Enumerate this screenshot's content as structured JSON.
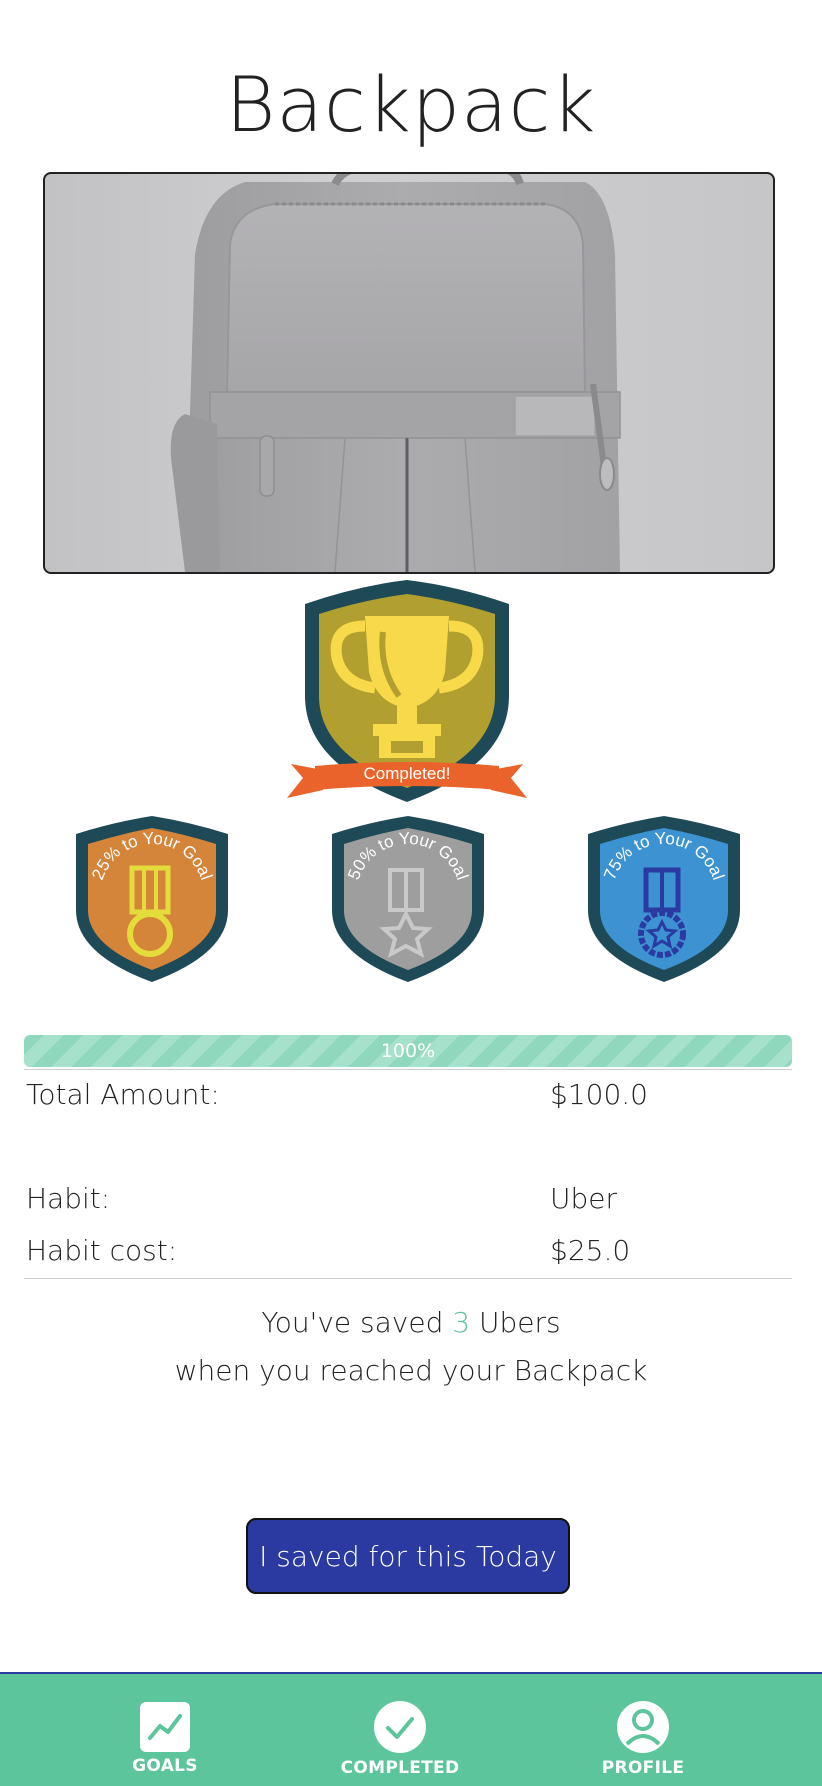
{
  "goal": {
    "title": "Backpack"
  },
  "badges": {
    "completed_label": "Completed!",
    "milestone_25_label": "25% to Your Goal",
    "milestone_50_label": "50% to Your Goal",
    "milestone_75_label": "75% to Your Goal",
    "colors": {
      "shield_border": "#1e4a57",
      "gold": "#b19f30",
      "trophy": "#f8d94a",
      "ribbon": "#e9632a",
      "bronze": "#d4853a",
      "silver": "#9e9e9e",
      "blue": "#3d93d2"
    }
  },
  "progress": {
    "value": 1.0,
    "label": "100%",
    "color": "#8fd8bd"
  },
  "details": {
    "total_amount_label": "Total Amount:",
    "total_amount_value": "$100.0",
    "habit_label": "Habit:",
    "habit_value": "Uber",
    "habit_cost_label": "Habit cost:",
    "habit_cost_value": "$25.0"
  },
  "summary": {
    "line1_prefix": "You've saved",
    "count": "3",
    "line1_suffix": "Ubers",
    "line2": "when you reached your Backpack"
  },
  "actions": {
    "save_button_label": "I saved for this Today"
  },
  "nav": {
    "goals_label": "GOALS",
    "completed_label": "COMPLETED",
    "profile_label": "PROFILE",
    "background": "#5cc59b"
  }
}
